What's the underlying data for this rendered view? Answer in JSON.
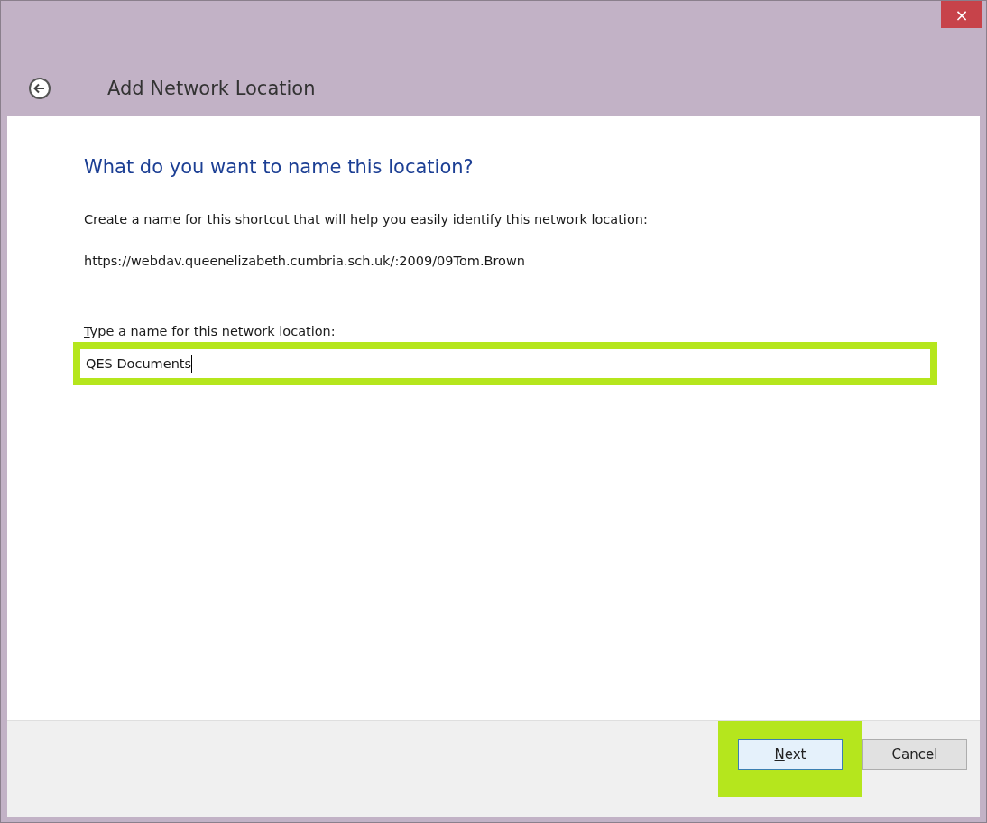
{
  "window": {
    "title": "Add Network Location",
    "close": "×"
  },
  "heading": "What do you want to name this location?",
  "instruction": "Create a name for this shortcut that will help you easily identify this network location:",
  "address": "https://webdav.queenelizabeth.cumbria.sch.uk/:2009/09Tom.Brown",
  "name_field": {
    "label": "Type a name for this network location:",
    "label_access_key_underlined": true,
    "value": "QES Documents",
    "highlighted": true
  },
  "buttons": [
    {
      "label": "Next",
      "kind": "default",
      "access_key_underlined": true,
      "highlighted": true
    },
    {
      "label": "Cancel",
      "kind": "normal",
      "access_key_underlined": false,
      "highlighted": false
    }
  ]
}
